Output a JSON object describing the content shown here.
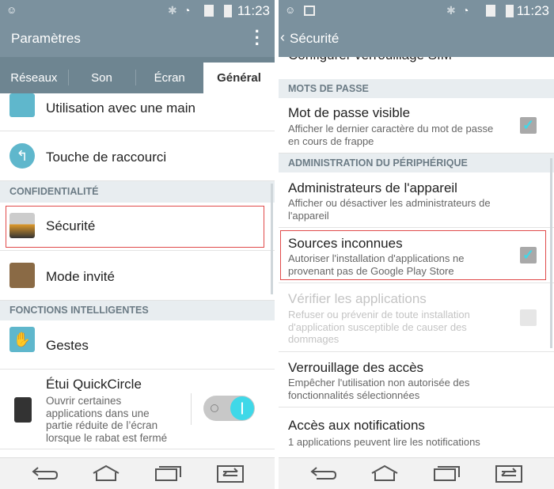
{
  "status": {
    "time": "11:23"
  },
  "left": {
    "title": "Paramètres",
    "tabs": [
      "Réseaux",
      "Son",
      "Écran",
      "Général"
    ],
    "items": {
      "one_hand": "Utilisation avec une main",
      "shortcut": "Touche de raccourci",
      "sec_privacy": "CONFIDENTIALITÉ",
      "security": "Sécurité",
      "guest": "Mode invité",
      "sec_smart": "FONCTIONS INTELLIGENTES",
      "gestures": "Gestes",
      "quickcircle": "Étui QuickCircle",
      "quickcircle_sub": "Ouvrir certaines applications dans une partie réduite de l’écran lorsque le rabat est fermé"
    },
    "quickcircle_toggle": "on"
  },
  "right": {
    "title": "Sécurité",
    "items": {
      "sim": "Configurer verrouillage SIM",
      "sec_pass": "MOTS DE PASSE",
      "pw_visible": "Mot de passe visible",
      "pw_visible_sub": "Afficher le dernier caractère du mot de passe en cours de frappe",
      "sec_admin": "ADMINISTRATION DU PÉRIPHÉRIQUE",
      "admins": "Administrateurs de l'appareil",
      "admins_sub": "Afficher ou désactiver les administrateurs de l'appareil",
      "unknown": "Sources inconnues",
      "unknown_sub": "Autoriser l'installation d'applications ne provenant pas de Google Play Store",
      "verify": "Vérifier les applications",
      "verify_sub": "Refuser ou prévenir de toute installation d'application susceptible de causer des dommages",
      "lock": "Verrouillage des accès",
      "lock_sub": "Empêcher l'utilisation non autorisée des fonctionnalités sélectionnées",
      "notif": "Accès aux notifications",
      "notif_sub": "1 applications peuvent lire les notifications"
    },
    "checked": {
      "pw_visible": true,
      "unknown": true,
      "verify": false
    }
  },
  "colors": {
    "bar": "#7b919e",
    "highlight": "#e04a4a",
    "accent": "#3fd8e8"
  }
}
